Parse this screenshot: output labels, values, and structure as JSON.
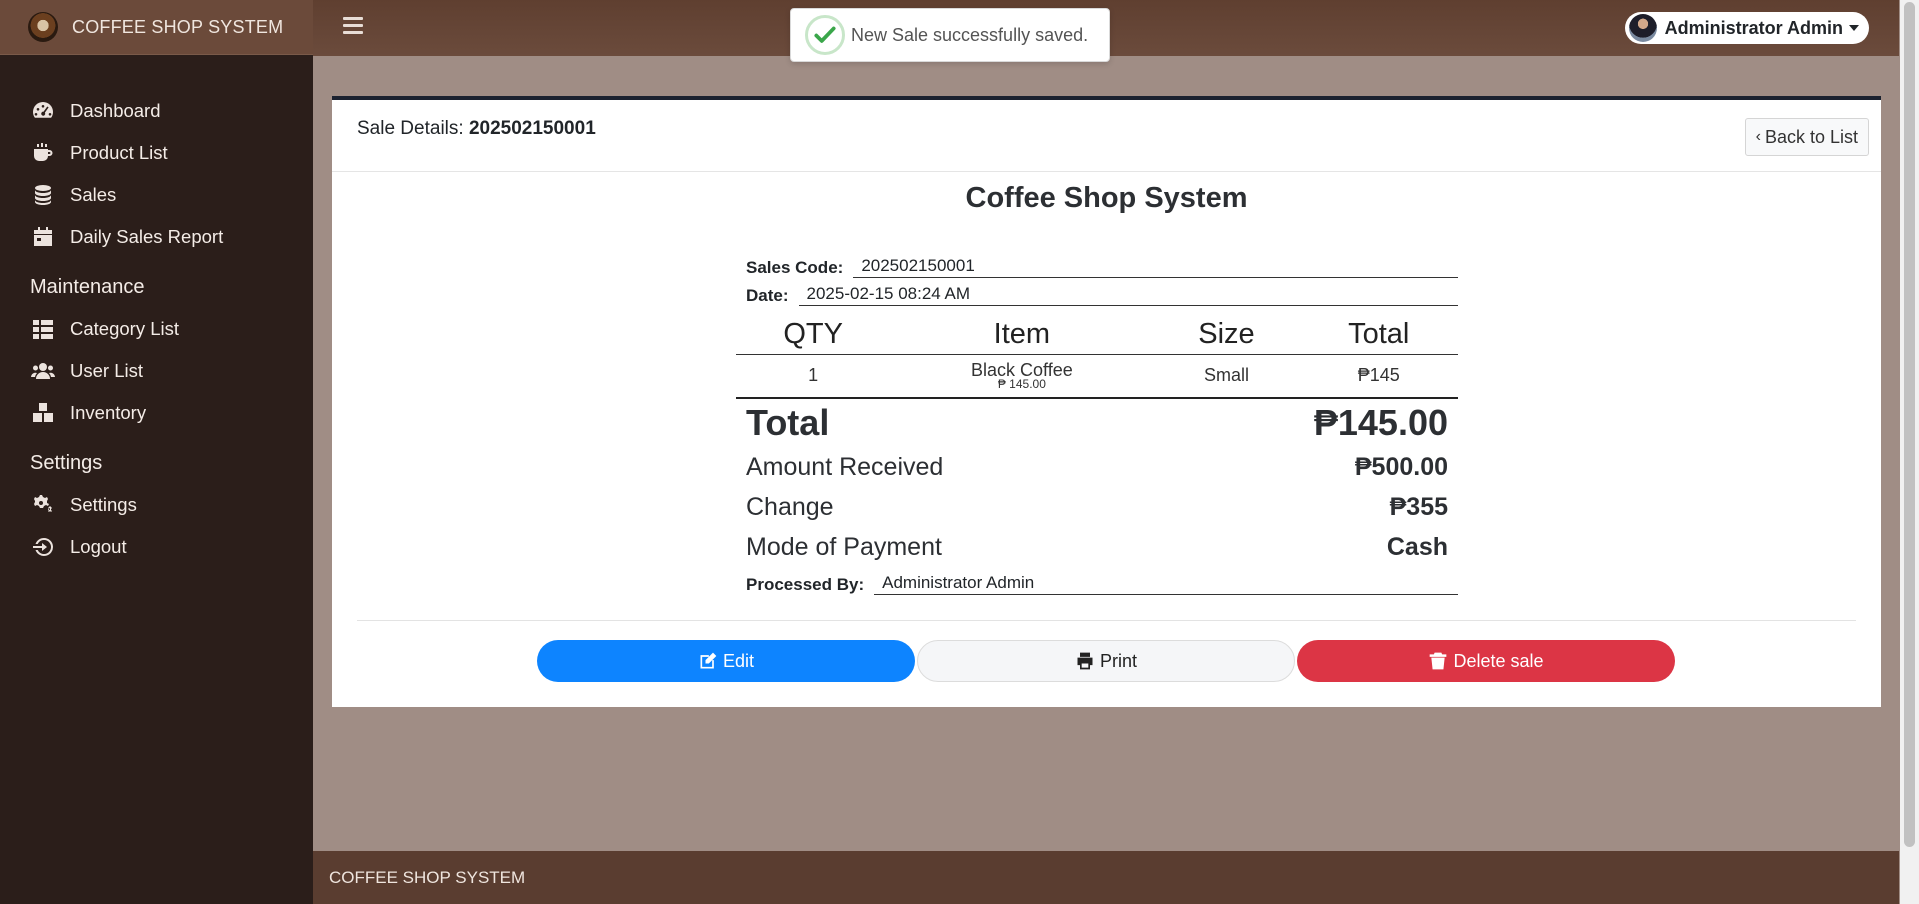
{
  "brand": {
    "title": "COFFEE SHOP SYSTEM"
  },
  "sidebar": {
    "items": [
      {
        "label": "Dashboard",
        "icon": "dashboard-icon"
      },
      {
        "label": "Product List",
        "icon": "coffee-cup-icon"
      },
      {
        "label": "Sales",
        "icon": "coins-icon"
      },
      {
        "label": "Daily Sales Report",
        "icon": "calendar-icon"
      }
    ],
    "maintenance_header": "Maintenance",
    "maintenance_items": [
      {
        "label": "Category List",
        "icon": "table-list-icon"
      },
      {
        "label": "User List",
        "icon": "users-icon"
      },
      {
        "label": "Inventory",
        "icon": "boxes-icon"
      }
    ],
    "settings_header": "Settings",
    "settings_items": [
      {
        "label": "Settings",
        "icon": "gears-icon"
      },
      {
        "label": "Logout",
        "icon": "logout-icon"
      }
    ]
  },
  "topbar": {
    "user_name": "Administrator Admin"
  },
  "toast": {
    "message": "New Sale successfully saved."
  },
  "card": {
    "title_prefix": "Sale Details: ",
    "sale_code": "202502150001",
    "back_label": "Back to List"
  },
  "receipt": {
    "shop_name": "Coffee Shop System",
    "sales_code_label": "Sales Code:",
    "sales_code": "202502150001",
    "date_label": "Date:",
    "date": "2025-02-15 08:24 AM",
    "columns": [
      "QTY",
      "Item",
      "Size",
      "Total"
    ],
    "rows": [
      {
        "qty": "1",
        "item": "Black Coffee",
        "price": "₱ 145.00",
        "size": "Small",
        "total": "₱145"
      }
    ],
    "total_label": "Total",
    "total": "₱145.00",
    "amount_received_label": "Amount Received",
    "amount_received": "₱500.00",
    "change_label": "Change",
    "change": "₱355",
    "mode_label": "Mode of Payment",
    "mode": "Cash",
    "processed_label": "Processed By:",
    "processed_by": "Administrator Admin"
  },
  "actions": {
    "edit": "Edit",
    "print": "Print",
    "delete": "Delete sale"
  },
  "footer": {
    "text": "COFFEE SHOP SYSTEM"
  },
  "colors": {
    "accent": "#0d84ff",
    "danger": "#dc3545",
    "sidebar": "#2b1e1a",
    "topbar": "#6b4b3c"
  }
}
